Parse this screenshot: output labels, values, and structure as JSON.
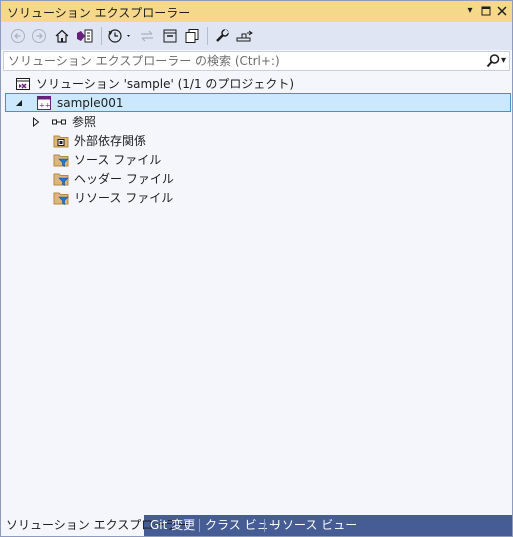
{
  "window": {
    "title": "ソリューション エクスプローラー",
    "controls": [
      "dropdown-icon",
      "maximize-icon",
      "close-icon"
    ]
  },
  "toolbar": {
    "buttons": [
      "back-icon",
      "forward-icon",
      "home-icon",
      "switch-views-icon",
      "pending-changes-filter-icon",
      "sync-icon",
      "collapse-all-icon",
      "show-all-files-icon",
      "properties-icon",
      "preview-icon"
    ]
  },
  "search": {
    "placeholder": "ソリューション エクスプローラー の検索 (Ctrl+:)"
  },
  "tree": {
    "solution_label": "ソリューション 'sample' (1/1 のプロジェクト)",
    "project_label": "sample001",
    "items": [
      {
        "label": "参照",
        "icon": "references-icon"
      },
      {
        "label": "外部依存関係",
        "icon": "external-dependencies-icon"
      },
      {
        "label": "ソース ファイル",
        "icon": "filter-folder-icon"
      },
      {
        "label": "ヘッダー ファイル",
        "icon": "filter-folder-icon"
      },
      {
        "label": "リソース ファイル",
        "icon": "filter-folder-icon"
      }
    ]
  },
  "bottom_tabs": [
    {
      "label": "ソリューション エクスプローラー",
      "active": true
    },
    {
      "label": "Git 変更",
      "active": false
    },
    {
      "label": "クラス ビュー",
      "active": false
    },
    {
      "label": "リソース ビュー",
      "active": false
    }
  ],
  "colors": {
    "titlebar": "#f6d88b",
    "toolbar": "#dfe5f2",
    "panel": "#f5f6fb",
    "selection": "#cce8ff",
    "tabstrip": "#455c94"
  }
}
